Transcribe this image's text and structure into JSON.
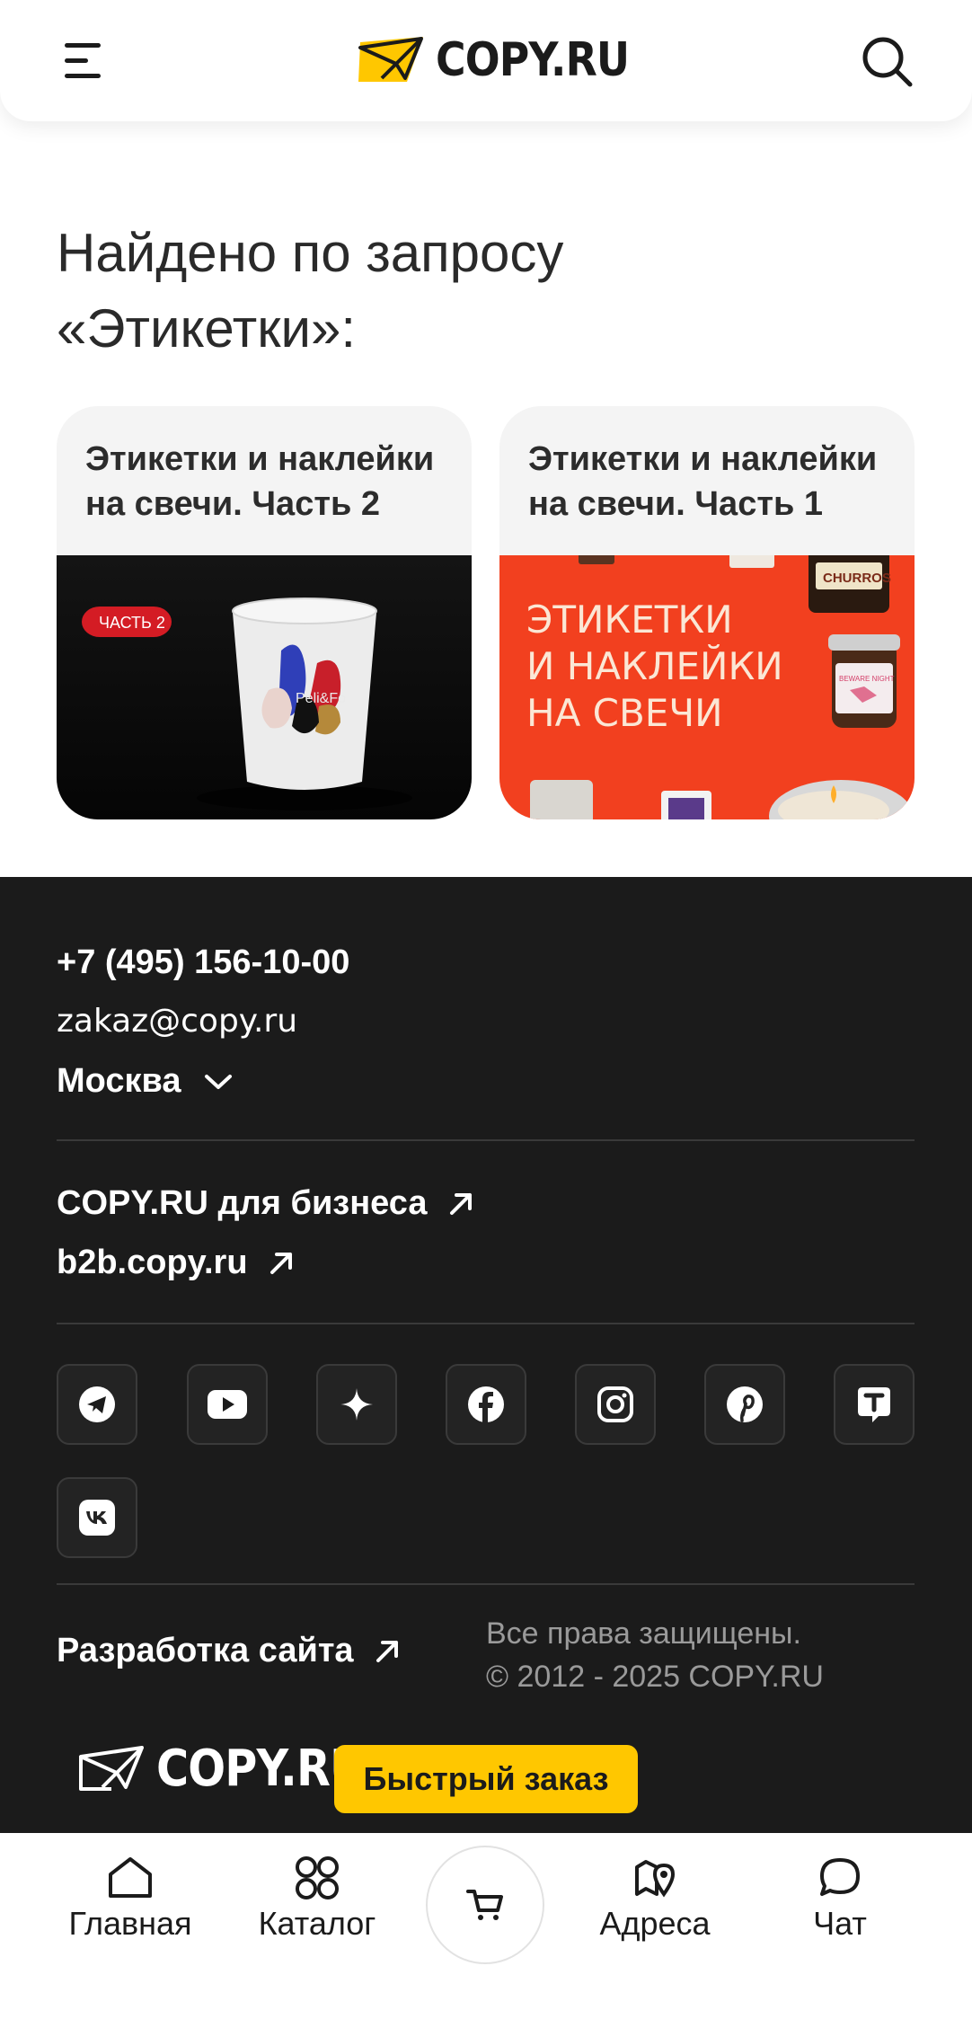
{
  "header": {
    "logo_text": "COPY.RU",
    "menu_icon": "burger-menu-icon",
    "search_icon": "search-icon"
  },
  "main": {
    "title": "Найдено по запросу «Этикетки»:",
    "cards": [
      {
        "title": "Этикетки и наклейки на свечи. Часть 2",
        "image_badge": "ЧАСТЬ 2",
        "image_product_text": "Peli&Fo"
      },
      {
        "title": "Этикетки и наклейки на свечи. Часть 1",
        "image_headline": [
          "ЭТИКЕТКИ",
          "И НАКЛЕЙКИ",
          "НА СВЕЧИ"
        ],
        "image_jar_label": "CHURROS",
        "image_jar_label2": "BEWARE NIGHT"
      }
    ]
  },
  "footer": {
    "phone": "+7 (495) 156-10-00",
    "email": "zakaz@copy.ru",
    "city": "Москва",
    "business_link": "COPY.RU для бизнеса",
    "b2b_link": "b2b.copy.ru",
    "socials": [
      "telegram-icon",
      "youtube-icon",
      "zen-icon",
      "facebook-icon",
      "instagram-icon",
      "pinterest-icon",
      "tenchat-icon",
      "vk-icon"
    ],
    "dev_link": "Разработка сайта",
    "rights": "Все права защищены.",
    "copyright": "© 2012 - 2025 COPY.RU",
    "logo_text": "COPY.RU"
  },
  "quick_order": "Быстрый заказ",
  "bottom_nav": {
    "home": "Главная",
    "catalog": "Каталог",
    "addresses": "Адреса",
    "chat": "Чат"
  },
  "colors": {
    "accent": "#ffc700",
    "footer_bg": "#1b1b1b",
    "card_red": "#f2401f"
  }
}
